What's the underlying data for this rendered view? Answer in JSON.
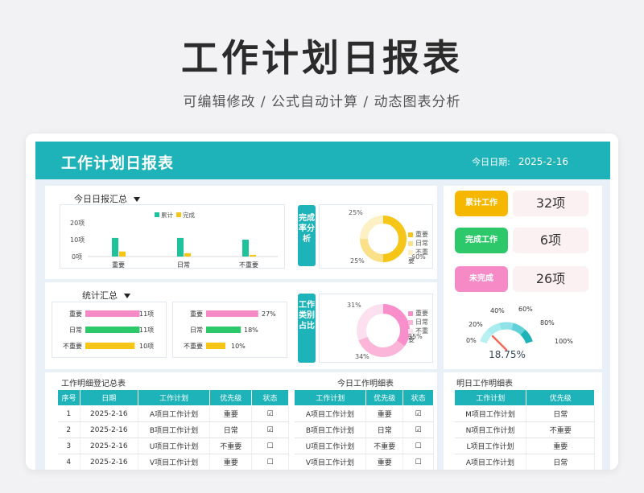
{
  "hero": {
    "title": "工作计划日报表",
    "subtitle": "可编辑修改 /  公式自动计算  /  动态图表分析"
  },
  "header": {
    "title": "工作计划日报表",
    "date_label": "今日日期:",
    "date_value": "2025-2-16"
  },
  "daily_summary": {
    "label": "今日日报汇总",
    "legend": [
      "累计",
      "完成"
    ],
    "y_ticks": [
      "20项",
      "10项",
      "0项"
    ],
    "categories": [
      "重要",
      "日常",
      "不重要"
    ]
  },
  "completion_badge": "完成率分析",
  "completion_pie": {
    "labels": [
      "25%",
      "25%",
      "50%"
    ],
    "legend": [
      "重要",
      "日常",
      "不重要"
    ]
  },
  "stats_summary": {
    "label": "统计汇总",
    "counts": [
      {
        "name": "重要",
        "value": "11项"
      },
      {
        "name": "日常",
        "value": "11项"
      },
      {
        "name": "不重要",
        "value": "10项"
      }
    ],
    "percents": [
      {
        "name": "重要",
        "value": "27%"
      },
      {
        "name": "日常",
        "value": "18%"
      },
      {
        "name": "不重要",
        "value": "10%"
      }
    ]
  },
  "category_badge": "工作类别占比",
  "category_pie": {
    "labels": [
      "31%",
      "35%",
      "34%"
    ],
    "legend": [
      "重要",
      "日常",
      "不重要"
    ]
  },
  "kpis": [
    {
      "label": "累计工作",
      "value": "32项",
      "color": "#f5b700"
    },
    {
      "label": "完成工作",
      "value": "6项",
      "color": "#2dc86a"
    },
    {
      "label": "未完成",
      "value": "26项",
      "color": "#f58ac6"
    }
  ],
  "gauge": {
    "ticks": [
      "0%",
      "20%",
      "40%",
      "60%",
      "80%",
      "100%"
    ],
    "value_text": "18.75%",
    "value": 0.1875
  },
  "ledger": {
    "title": "工作明细登记总表",
    "headers": [
      "序号",
      "日期",
      "工作计划",
      "优先级",
      "状态"
    ],
    "rows": [
      [
        "1",
        "2025-2-16",
        "A项目工作计划",
        "重要",
        "☑"
      ],
      [
        "2",
        "2025-2-16",
        "B项目工作计划",
        "日常",
        "☑"
      ],
      [
        "3",
        "2025-2-16",
        "U项目工作计划",
        "不重要",
        "☐"
      ],
      [
        "4",
        "2025-2-16",
        "V项目工作计划",
        "重要",
        "☐"
      ]
    ]
  },
  "today": {
    "title": "今日工作明细表",
    "headers": [
      "工作计划",
      "优先级",
      "状态"
    ],
    "rows": [
      [
        "A项目工作计划",
        "重要",
        "☑"
      ],
      [
        "B项目工作计划",
        "日常",
        "☑"
      ],
      [
        "U项目工作计划",
        "不重要",
        "☐"
      ],
      [
        "V项目工作计划",
        "重要",
        "☐"
      ]
    ]
  },
  "tomorrow": {
    "title": "明日工作明细表",
    "headers": [
      "工作计划",
      "优先级"
    ],
    "rows": [
      [
        "M项目工作计划",
        "日常"
      ],
      [
        "N项目工作计划",
        "不重要"
      ],
      [
        "L项目工作计划",
        "重要"
      ],
      [
        "A项目工作计划",
        "日常"
      ]
    ]
  },
  "chart_data": [
    {
      "type": "bar",
      "categories": [
        "重要",
        "日常",
        "不重要"
      ],
      "series": [
        {
          "name": "累计",
          "values": [
            11,
            11,
            10
          ],
          "color": "#1fc29a"
        },
        {
          "name": "完成",
          "values": [
            3,
            2,
            1
          ],
          "color": "#f5c518"
        }
      ],
      "ylim": [
        0,
        20
      ]
    },
    {
      "type": "pie",
      "labels": [
        "重要",
        "日常",
        "不重要"
      ],
      "values": [
        50,
        25,
        25
      ],
      "colors": [
        "#f5c518",
        "#fbe08a",
        "#fdf0c4"
      ]
    },
    {
      "type": "bar",
      "categories": [
        "重要",
        "日常",
        "不重要"
      ],
      "values": [
        11,
        11,
        10
      ],
      "colors": [
        "#f58ac6",
        "#2dc86a",
        "#f5c518"
      ],
      "xlim": [
        0,
        15
      ]
    },
    {
      "type": "bar",
      "categories": [
        "重要",
        "日常",
        "不重要"
      ],
      "values": [
        27,
        18,
        10
      ],
      "colors": [
        "#f58ac6",
        "#2dc86a",
        "#f5c518"
      ],
      "xlim": [
        0,
        35
      ]
    },
    {
      "type": "pie",
      "labels": [
        "重要",
        "日常",
        "不重要"
      ],
      "values": [
        35,
        34,
        31
      ],
      "colors": [
        "#f88fcb",
        "#fbb5d8",
        "#fde0ef"
      ]
    }
  ]
}
